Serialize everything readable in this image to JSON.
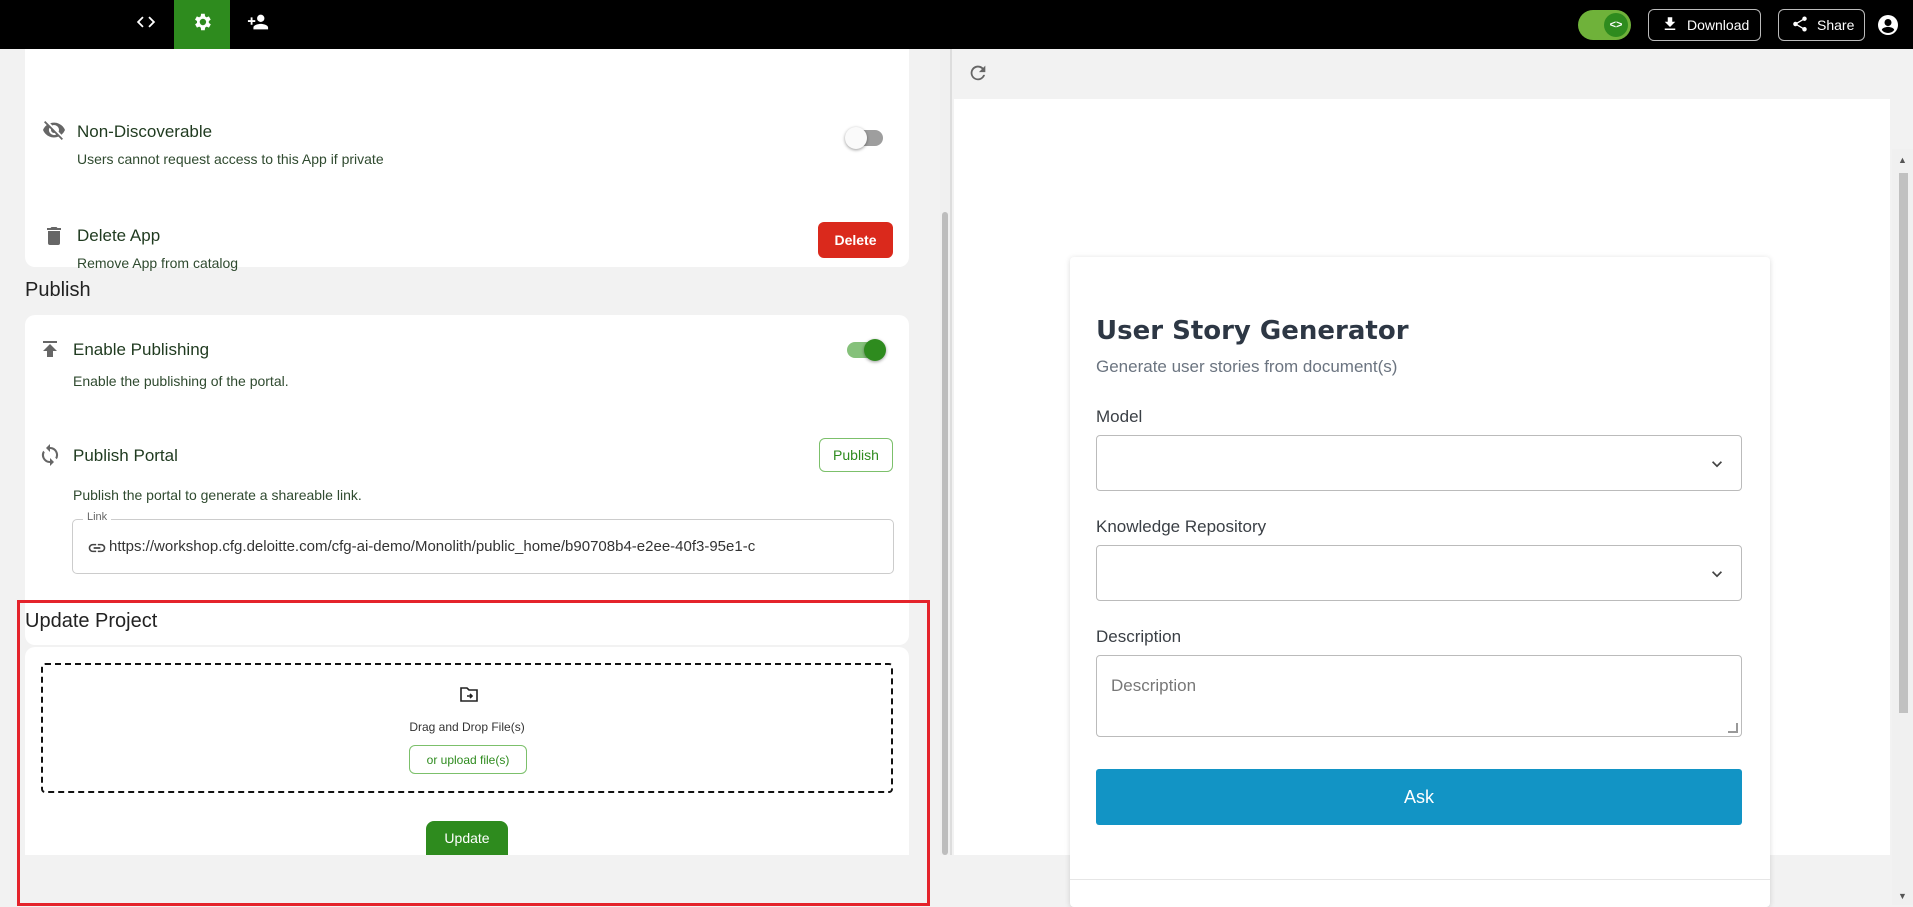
{
  "topbar": {
    "download_label": "Download",
    "share_label": "Share",
    "colors": {
      "bar": "#000000",
      "active_tab": "#2e8b1e"
    },
    "icons": [
      "code-icon",
      "gear-icon",
      "add-user-icon",
      "code-toggle-icon",
      "download-icon",
      "share-icon",
      "account-icon"
    ]
  },
  "settings": {
    "non_discoverable": {
      "title": "Non-Discoverable",
      "description": "Users cannot request access to this App if private",
      "enabled": false
    },
    "delete_app": {
      "title": "Delete App",
      "description": "Remove App from catalog",
      "button_label": "Delete"
    }
  },
  "publish": {
    "heading": "Publish",
    "enable_publishing": {
      "title": "Enable Publishing",
      "description": "Enable the publishing of the portal.",
      "enabled": true
    },
    "publish_portal": {
      "title": "Publish Portal",
      "description": "Publish the portal to generate a shareable link.",
      "button_label": "Publish"
    },
    "link": {
      "label": "Link",
      "value": "https://workshop.cfg.deloitte.com/cfg-ai-demo/Monolith/public_home/b90708b4-e2ee-40f3-95e1-c"
    }
  },
  "update_project": {
    "heading": "Update Project",
    "drop_text": "Drag and Drop File(s)",
    "upload_label": "or upload file(s)",
    "update_label": "Update"
  },
  "preview": {
    "title": "User Story Generator",
    "subtitle": "Generate user stories from document(s)",
    "model_label": "Model",
    "model_value": "",
    "repo_label": "Knowledge Repository",
    "repo_value": "",
    "description_label": "Description",
    "description_placeholder": "Description",
    "ask_label": "Ask",
    "colors": {
      "ask_button": "#1294c5"
    }
  }
}
